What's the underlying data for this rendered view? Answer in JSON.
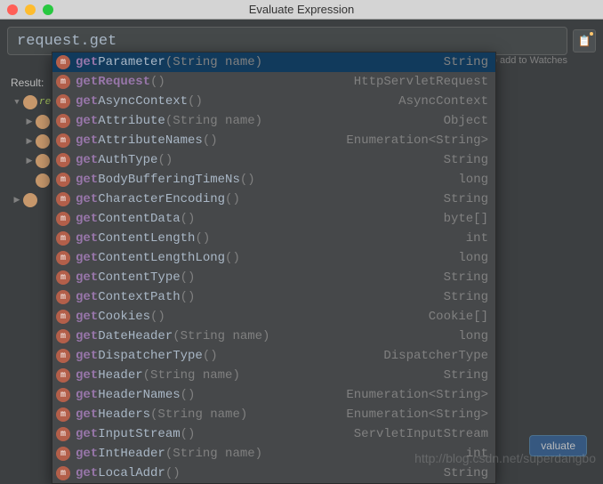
{
  "window": {
    "title": "Evaluate Expression"
  },
  "input": {
    "value": "request.get",
    "hint": "r to add to Watches"
  },
  "result_label": "Result:",
  "tree": {
    "items": [
      {
        "indent": 0,
        "arrow": "▼",
        "label": "re"
      },
      {
        "indent": 1,
        "arrow": "▶",
        "label": ""
      },
      {
        "indent": 1,
        "arrow": "▶",
        "label": ""
      },
      {
        "indent": 1,
        "arrow": "▶",
        "label": ""
      },
      {
        "indent": 1,
        "arrow": "",
        "label": ""
      },
      {
        "indent": 0,
        "arrow": "▶",
        "label": ""
      }
    ]
  },
  "completions": [
    {
      "prefix": "get",
      "rest": "Parameter",
      "params": "(String name)",
      "type": "String",
      "selected": true
    },
    {
      "prefix": "get",
      "rest": "Request",
      "params": "()",
      "type": "HttpServletRequest",
      "bold_rest": true
    },
    {
      "prefix": "get",
      "rest": "AsyncContext",
      "params": "()",
      "type": "AsyncContext"
    },
    {
      "prefix": "get",
      "rest": "Attribute",
      "params": "(String name)",
      "type": "Object"
    },
    {
      "prefix": "get",
      "rest": "AttributeNames",
      "params": "()",
      "type": "Enumeration<String>"
    },
    {
      "prefix": "get",
      "rest": "AuthType",
      "params": "()",
      "type": "String"
    },
    {
      "prefix": "get",
      "rest": "BodyBufferingTimeNs",
      "params": "()",
      "type": "long"
    },
    {
      "prefix": "get",
      "rest": "CharacterEncoding",
      "params": "()",
      "type": "String"
    },
    {
      "prefix": "get",
      "rest": "ContentData",
      "params": "()",
      "type": "byte[]"
    },
    {
      "prefix": "get",
      "rest": "ContentLength",
      "params": "()",
      "type": "int"
    },
    {
      "prefix": "get",
      "rest": "ContentLengthLong",
      "params": "()",
      "type": "long"
    },
    {
      "prefix": "get",
      "rest": "ContentType",
      "params": "()",
      "type": "String"
    },
    {
      "prefix": "get",
      "rest": "ContextPath",
      "params": "()",
      "type": "String"
    },
    {
      "prefix": "get",
      "rest": "Cookies",
      "params": "()",
      "type": "Cookie[]"
    },
    {
      "prefix": "get",
      "rest": "DateHeader",
      "params": "(String name)",
      "type": "long"
    },
    {
      "prefix": "get",
      "rest": "DispatcherType",
      "params": "()",
      "type": "DispatcherType"
    },
    {
      "prefix": "get",
      "rest": "Header",
      "params": "(String name)",
      "type": "String"
    },
    {
      "prefix": "get",
      "rest": "HeaderNames",
      "params": "()",
      "type": "Enumeration<String>"
    },
    {
      "prefix": "get",
      "rest": "Headers",
      "params": "(String name)",
      "type": "Enumeration<String>"
    },
    {
      "prefix": "get",
      "rest": "InputStream",
      "params": "()",
      "type": "ServletInputStream"
    },
    {
      "prefix": "get",
      "rest": "IntHeader",
      "params": "(String name)",
      "type": "int"
    },
    {
      "prefix": "get",
      "rest": "LocalAddr",
      "params": "()",
      "type": "String"
    }
  ],
  "evaluate_label": "valuate",
  "watermark": "http://blog.csdn.net/superdangbo"
}
